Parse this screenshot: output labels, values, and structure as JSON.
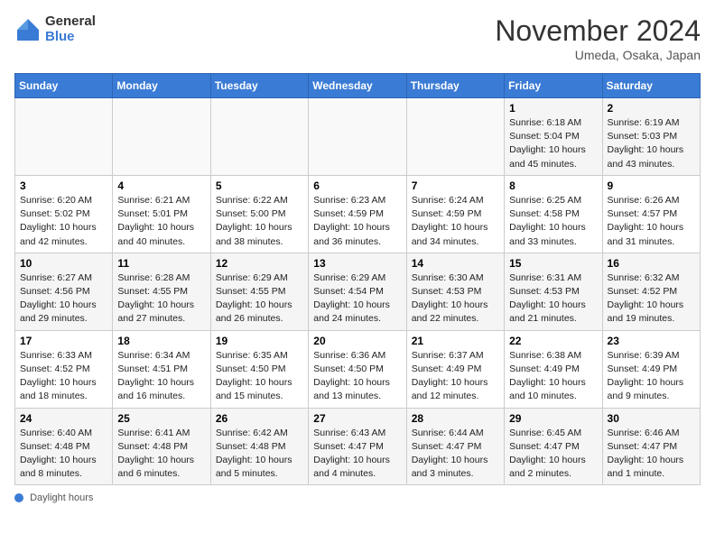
{
  "header": {
    "logo_line1": "General",
    "logo_line2": "Blue",
    "month_title": "November 2024",
    "location": "Umeda, Osaka, Japan"
  },
  "days_of_week": [
    "Sunday",
    "Monday",
    "Tuesday",
    "Wednesday",
    "Thursday",
    "Friday",
    "Saturday"
  ],
  "weeks": [
    [
      {
        "day": "",
        "info": ""
      },
      {
        "day": "",
        "info": ""
      },
      {
        "day": "",
        "info": ""
      },
      {
        "day": "",
        "info": ""
      },
      {
        "day": "",
        "info": ""
      },
      {
        "day": "1",
        "info": "Sunrise: 6:18 AM\nSunset: 5:04 PM\nDaylight: 10 hours\nand 45 minutes."
      },
      {
        "day": "2",
        "info": "Sunrise: 6:19 AM\nSunset: 5:03 PM\nDaylight: 10 hours\nand 43 minutes."
      }
    ],
    [
      {
        "day": "3",
        "info": "Sunrise: 6:20 AM\nSunset: 5:02 PM\nDaylight: 10 hours\nand 42 minutes."
      },
      {
        "day": "4",
        "info": "Sunrise: 6:21 AM\nSunset: 5:01 PM\nDaylight: 10 hours\nand 40 minutes."
      },
      {
        "day": "5",
        "info": "Sunrise: 6:22 AM\nSunset: 5:00 PM\nDaylight: 10 hours\nand 38 minutes."
      },
      {
        "day": "6",
        "info": "Sunrise: 6:23 AM\nSunset: 4:59 PM\nDaylight: 10 hours\nand 36 minutes."
      },
      {
        "day": "7",
        "info": "Sunrise: 6:24 AM\nSunset: 4:59 PM\nDaylight: 10 hours\nand 34 minutes."
      },
      {
        "day": "8",
        "info": "Sunrise: 6:25 AM\nSunset: 4:58 PM\nDaylight: 10 hours\nand 33 minutes."
      },
      {
        "day": "9",
        "info": "Sunrise: 6:26 AM\nSunset: 4:57 PM\nDaylight: 10 hours\nand 31 minutes."
      }
    ],
    [
      {
        "day": "10",
        "info": "Sunrise: 6:27 AM\nSunset: 4:56 PM\nDaylight: 10 hours\nand 29 minutes."
      },
      {
        "day": "11",
        "info": "Sunrise: 6:28 AM\nSunset: 4:55 PM\nDaylight: 10 hours\nand 27 minutes."
      },
      {
        "day": "12",
        "info": "Sunrise: 6:29 AM\nSunset: 4:55 PM\nDaylight: 10 hours\nand 26 minutes."
      },
      {
        "day": "13",
        "info": "Sunrise: 6:29 AM\nSunset: 4:54 PM\nDaylight: 10 hours\nand 24 minutes."
      },
      {
        "day": "14",
        "info": "Sunrise: 6:30 AM\nSunset: 4:53 PM\nDaylight: 10 hours\nand 22 minutes."
      },
      {
        "day": "15",
        "info": "Sunrise: 6:31 AM\nSunset: 4:53 PM\nDaylight: 10 hours\nand 21 minutes."
      },
      {
        "day": "16",
        "info": "Sunrise: 6:32 AM\nSunset: 4:52 PM\nDaylight: 10 hours\nand 19 minutes."
      }
    ],
    [
      {
        "day": "17",
        "info": "Sunrise: 6:33 AM\nSunset: 4:52 PM\nDaylight: 10 hours\nand 18 minutes."
      },
      {
        "day": "18",
        "info": "Sunrise: 6:34 AM\nSunset: 4:51 PM\nDaylight: 10 hours\nand 16 minutes."
      },
      {
        "day": "19",
        "info": "Sunrise: 6:35 AM\nSunset: 4:50 PM\nDaylight: 10 hours\nand 15 minutes."
      },
      {
        "day": "20",
        "info": "Sunrise: 6:36 AM\nSunset: 4:50 PM\nDaylight: 10 hours\nand 13 minutes."
      },
      {
        "day": "21",
        "info": "Sunrise: 6:37 AM\nSunset: 4:49 PM\nDaylight: 10 hours\nand 12 minutes."
      },
      {
        "day": "22",
        "info": "Sunrise: 6:38 AM\nSunset: 4:49 PM\nDaylight: 10 hours\nand 10 minutes."
      },
      {
        "day": "23",
        "info": "Sunrise: 6:39 AM\nSunset: 4:49 PM\nDaylight: 10 hours\nand 9 minutes."
      }
    ],
    [
      {
        "day": "24",
        "info": "Sunrise: 6:40 AM\nSunset: 4:48 PM\nDaylight: 10 hours\nand 8 minutes."
      },
      {
        "day": "25",
        "info": "Sunrise: 6:41 AM\nSunset: 4:48 PM\nDaylight: 10 hours\nand 6 minutes."
      },
      {
        "day": "26",
        "info": "Sunrise: 6:42 AM\nSunset: 4:48 PM\nDaylight: 10 hours\nand 5 minutes."
      },
      {
        "day": "27",
        "info": "Sunrise: 6:43 AM\nSunset: 4:47 PM\nDaylight: 10 hours\nand 4 minutes."
      },
      {
        "day": "28",
        "info": "Sunrise: 6:44 AM\nSunset: 4:47 PM\nDaylight: 10 hours\nand 3 minutes."
      },
      {
        "day": "29",
        "info": "Sunrise: 6:45 AM\nSunset: 4:47 PM\nDaylight: 10 hours\nand 2 minutes."
      },
      {
        "day": "30",
        "info": "Sunrise: 6:46 AM\nSunset: 4:47 PM\nDaylight: 10 hours\nand 1 minute."
      }
    ]
  ],
  "footer": {
    "daylight_label": "Daylight hours"
  }
}
